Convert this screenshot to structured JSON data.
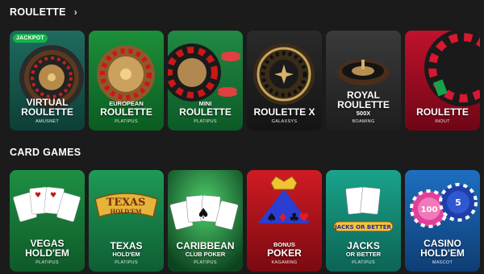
{
  "sections": {
    "roulette": {
      "title": "ROULETTE",
      "chevron": "›"
    },
    "cards": {
      "title": "CARD GAMES"
    }
  },
  "roulette_games": [
    {
      "line1": "VIRTUAL",
      "line2": "ROULETTE",
      "provider": "AMUSNET",
      "badge": "JACKPOT",
      "bg": "#1f6b5e",
      "accent": "#0d3f37"
    },
    {
      "small": "EUROPEAN",
      "line2": "ROULETTE",
      "provider": "PLATIPUS",
      "bg": "#1c8f3a",
      "accent": "#0b5c22"
    },
    {
      "small": "MINI",
      "line2": "ROULETTE",
      "provider": "PLATIPUS",
      "bg": "#208a44",
      "accent": "#0d5a27"
    },
    {
      "line2": "ROULETTE X",
      "provider": "GALAXSYS",
      "bg": "#2a2a2a",
      "accent": "#141414"
    },
    {
      "line1": "ROYAL",
      "line2": "ROULETTE",
      "small2": "500X",
      "provider": "BOAMING",
      "bg": "#3a3a3a",
      "accent": "#1e1e1e"
    },
    {
      "line2": "ROULETTE",
      "provider": "INOUT",
      "bg": "#c0122d",
      "accent": "#6e0616"
    }
  ],
  "card_games": [
    {
      "line1": "VEGAS",
      "line2": "HOLD'EM",
      "provider": "PLATIPUS",
      "bg": "#1e8f43",
      "accent": "#0e5a28"
    },
    {
      "line1": "TEXAS",
      "small": "HOLD'EM",
      "provider": "PLATIPUS",
      "bg": "#1e9a56",
      "accent": "#0e5e33",
      "logo": "TEXAS",
      "logo2": "HOLD'EM"
    },
    {
      "line1": "CARIBBEAN",
      "small": "CLUB POKER",
      "provider": "PLATIPUS",
      "bg": "#1a7a3a",
      "accent": "#0c4420"
    },
    {
      "small": "BONUS",
      "line2": "POKER",
      "provider": "KAGAMING",
      "bg": "#d01b24",
      "accent": "#7a0a10"
    },
    {
      "line1": "JACKS",
      "small": "OR BETTER",
      "provider": "PLATIPUS",
      "bg": "#1aa38b",
      "accent": "#0c6455",
      "logo": "JACKS OR BETTER"
    },
    {
      "line1": "CASINO",
      "line2": "HOLD'EM",
      "provider": "MASCOT",
      "bg": "#1e6fc0",
      "accent": "#0e3d73",
      "chip1": "100",
      "chip2": "5"
    }
  ]
}
